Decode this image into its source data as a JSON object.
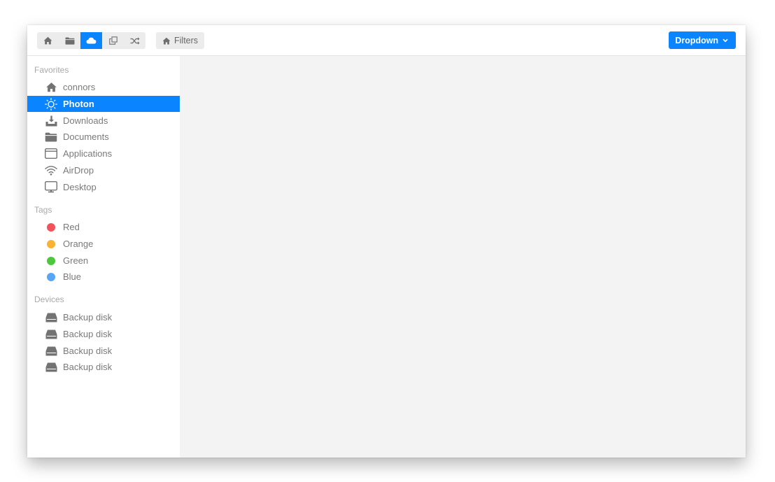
{
  "toolbar": {
    "buttons": [
      {
        "icon": "home-icon"
      },
      {
        "icon": "folder-icon"
      },
      {
        "icon": "cloud-icon",
        "active": true
      },
      {
        "icon": "popup-icon"
      },
      {
        "icon": "shuffle-icon"
      }
    ],
    "filters_label": "Filters",
    "dropdown_label": "Dropdown"
  },
  "sidebar": {
    "favorites_title": "Favorites",
    "favorites": [
      {
        "label": "connors",
        "icon": "home-icon"
      },
      {
        "label": "Photon",
        "icon": "light-up-icon",
        "selected": true
      },
      {
        "label": "Downloads",
        "icon": "download-icon"
      },
      {
        "label": "Documents",
        "icon": "folder-icon"
      },
      {
        "label": "Applications",
        "icon": "window-icon"
      },
      {
        "label": "AirDrop",
        "icon": "signal-icon"
      },
      {
        "label": "Desktop",
        "icon": "monitor-icon"
      }
    ],
    "tags_title": "Tags",
    "tags": [
      {
        "label": "Red",
        "color": "#f2525b"
      },
      {
        "label": "Orange",
        "color": "#f9b231"
      },
      {
        "label": "Green",
        "color": "#4dc83c"
      },
      {
        "label": "Blue",
        "color": "#56a6f4"
      }
    ],
    "devices_title": "Devices",
    "devices": [
      {
        "label": "Backup disk",
        "icon": "drive-icon"
      },
      {
        "label": "Backup disk",
        "icon": "drive-icon"
      },
      {
        "label": "Backup disk",
        "icon": "drive-icon"
      },
      {
        "label": "Backup disk",
        "icon": "drive-icon"
      }
    ]
  },
  "colors": {
    "accent": "#0b84ff",
    "sidebar_text": "#7a7a7a",
    "content_bg": "#f3f3f3"
  }
}
